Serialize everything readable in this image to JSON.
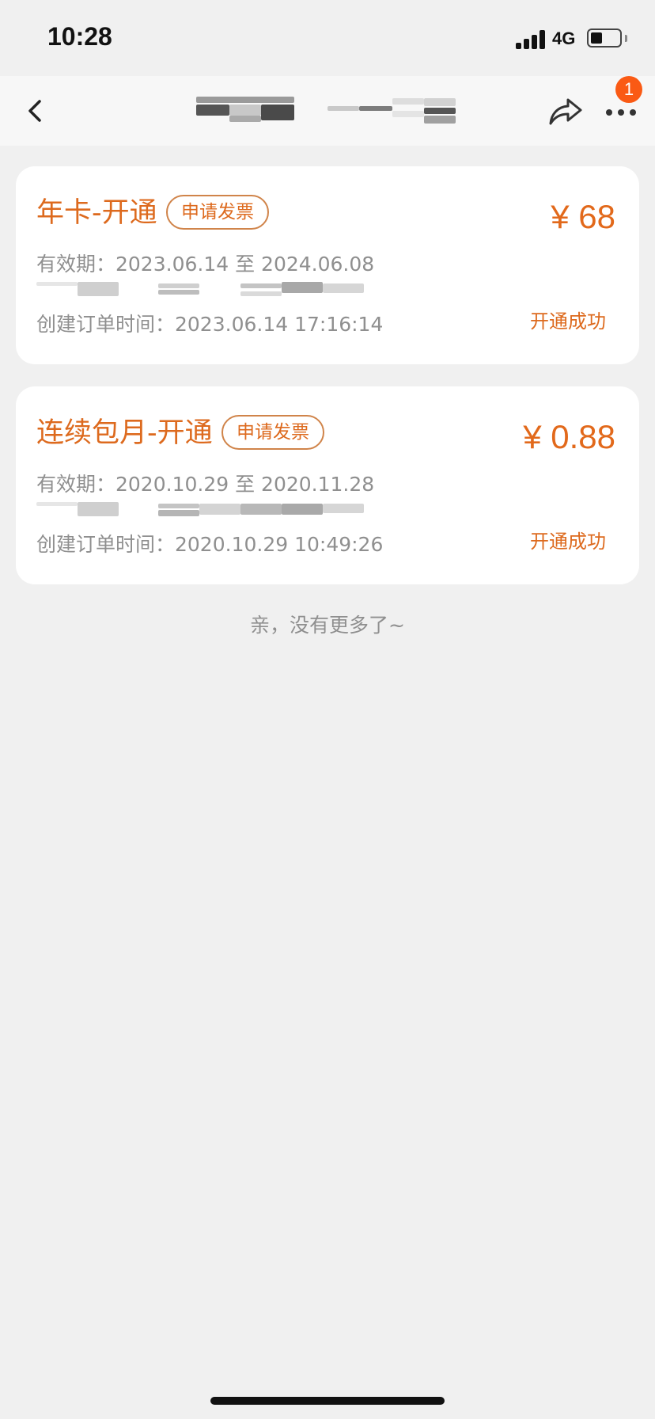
{
  "status_bar": {
    "time": "10:28",
    "network": "4G"
  },
  "nav": {
    "badge_count": "1",
    "icons": [
      "chevron-left-icon",
      "share-icon",
      "more-icon"
    ]
  },
  "orders": [
    {
      "title": "年卡-开通",
      "invoice_label": "申请发票",
      "price": "¥ 68",
      "validity": "有效期：2023.06.14 至 2024.06.08",
      "created": "创建订单时间：2023.06.14 17:16:14",
      "status": "开通成功"
    },
    {
      "title": "连续包月-开通",
      "invoice_label": "申请发票",
      "price": "¥ 0.88",
      "validity": "有效期：2020.10.29 至 2020.11.28",
      "created": "创建订单时间：2020.10.29 10:49:26",
      "status": "开通成功"
    }
  ],
  "footer_text": "亲，没有更多了~",
  "colors": {
    "accent": "#dd6a1e",
    "badge": "#fa5a14",
    "background": "#f0f0f0",
    "secondary_text": "#8f8f8f"
  }
}
